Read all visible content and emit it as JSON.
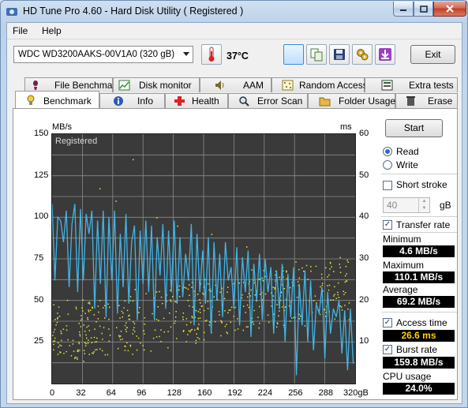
{
  "window": {
    "title": "HD Tune Pro 4.60 - Hard Disk Utility (  Registered )"
  },
  "menu": {
    "file": "File",
    "help": "Help"
  },
  "toolbar": {
    "drive": "WDC WD3200AAKS-00V1A0 (320 gB)",
    "temperature": "37°C",
    "exit_label": "Exit"
  },
  "tabs_top": [
    {
      "label": "File Benchmark",
      "icon": "file-benchmark-icon"
    },
    {
      "label": "Disk monitor",
      "icon": "disk-monitor-icon"
    },
    {
      "label": "AAM",
      "icon": "speaker-icon"
    },
    {
      "label": "Random Access",
      "icon": "random-access-icon"
    },
    {
      "label": "Extra tests",
      "icon": "extra-tests-icon"
    }
  ],
  "tabs_bottom": [
    {
      "label": "Benchmark",
      "icon": "benchmark-icon",
      "active": true
    },
    {
      "label": "Info",
      "icon": "info-icon"
    },
    {
      "label": "Health",
      "icon": "health-icon"
    },
    {
      "label": "Error Scan",
      "icon": "magnifier-icon"
    },
    {
      "label": "Folder Usage",
      "icon": "folder-icon"
    },
    {
      "label": "Erase",
      "icon": "trash-icon"
    }
  ],
  "side": {
    "start_label": "Start",
    "read_label": "Read",
    "write_label": "Write",
    "short_stroke_label": "Short stroke",
    "short_stroke_value": "40",
    "short_stroke_unit": "gB",
    "transfer_rate_label": "Transfer rate",
    "minimum_label": "Minimum",
    "minimum_value": "4.6 MB/s",
    "maximum_label": "Maximum",
    "maximum_value": "110.1 MB/s",
    "average_label": "Average",
    "average_value": "69.2 MB/s",
    "access_time_label": "Access time",
    "access_time_value": "26.6 ms",
    "burst_rate_label": "Burst rate",
    "burst_rate_value": "159.8 MB/s",
    "cpu_usage_label": "CPU usage",
    "cpu_usage_value": "24.0%"
  },
  "colors": {
    "transfer_line": "#3fb6e8",
    "access_points": "#e7e73a",
    "chart_bg": "#3a3a3a",
    "grid": "#8a8a8a"
  },
  "chart_data": {
    "type": "line",
    "watermark": "Registered",
    "ylabel_left": "MB/s",
    "ylabel_right": "ms",
    "x_ticks": [
      "0",
      "32",
      "64",
      "96",
      "128",
      "160",
      "192",
      "224",
      "256",
      "288",
      "320gB"
    ],
    "y_left_ticks": [
      "150",
      "125",
      "100",
      "75",
      "50",
      "25"
    ],
    "y_right_ticks": [
      "60",
      "50",
      "40",
      "30",
      "20",
      "10"
    ],
    "xlim": [
      0,
      320
    ],
    "ylim_left": [
      0,
      150
    ],
    "ylim_right": [
      0,
      60
    ],
    "grid": true,
    "series": [
      {
        "name": "Transfer rate",
        "axis": "left",
        "x": [
          0,
          3,
          6,
          9,
          12,
          15,
          18,
          21,
          24,
          27,
          30,
          33,
          36,
          39,
          42,
          45,
          48,
          51,
          54,
          57,
          60,
          63,
          66,
          69,
          72,
          75,
          78,
          81,
          84,
          87,
          90,
          93,
          96,
          99,
          102,
          105,
          108,
          111,
          114,
          117,
          120,
          123,
          126,
          129,
          132,
          135,
          138,
          141,
          144,
          147,
          150,
          153,
          156,
          159,
          162,
          165,
          168,
          171,
          174,
          177,
          180,
          183,
          186,
          189,
          192,
          195,
          198,
          201,
          204,
          207,
          210,
          213,
          216,
          219,
          222,
          225,
          228,
          231,
          234,
          237,
          240,
          243,
          246,
          249,
          252,
          255,
          258,
          261,
          264,
          267,
          270,
          273,
          276,
          279,
          282,
          285,
          288,
          291,
          294,
          297,
          300,
          303,
          306,
          309,
          312,
          315,
          318
        ],
        "y": [
          108,
          62,
          100,
          98,
          85,
          104,
          58,
          96,
          108,
          55,
          105,
          62,
          102,
          90,
          104,
          45,
          98,
          60,
          104,
          40,
          100,
          62,
          104,
          42,
          90,
          58,
          102,
          48,
          85,
          95,
          38,
          92,
          60,
          98,
          55,
          95,
          38,
          88,
          65,
          96,
          45,
          92,
          55,
          98,
          48,
          88,
          52,
          78,
          62,
          96,
          35,
          90,
          55,
          80,
          48,
          88,
          30,
          85,
          50,
          78,
          40,
          85,
          62,
          70,
          45,
          82,
          35,
          76,
          55,
          80,
          28,
          72,
          50,
          78,
          38,
          75,
          55,
          70,
          30,
          68,
          45,
          72,
          25,
          66,
          40,
          70,
          5,
          60,
          35,
          68,
          25,
          62,
          20,
          48,
          42,
          58,
          15,
          55,
          30,
          45,
          40,
          50,
          18,
          44,
          8,
          45,
          12
        ]
      },
      {
        "name": "Access time",
        "axis": "right",
        "type": "scatter",
        "trend": {
          "x": [
            0,
            320
          ],
          "y": [
            12,
            24
          ],
          "spread": 7
        }
      }
    ]
  }
}
